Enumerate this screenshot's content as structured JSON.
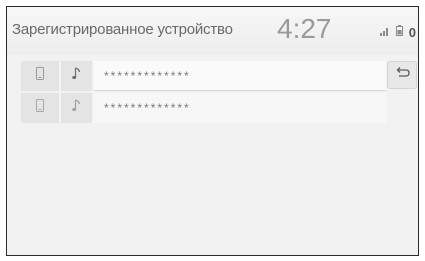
{
  "header": {
    "title": "Зарегистрированное устройство",
    "clock": "4:27",
    "status_value": "0"
  },
  "devices": [
    {
      "name": "*************",
      "phone_icon": "phone-icon",
      "audio_icon": "music-note-icon"
    },
    {
      "name": "*************",
      "phone_icon": "phone-icon",
      "audio_icon": "music-note-icon"
    }
  ],
  "controls": {
    "back_icon": "back-arrow-icon"
  }
}
